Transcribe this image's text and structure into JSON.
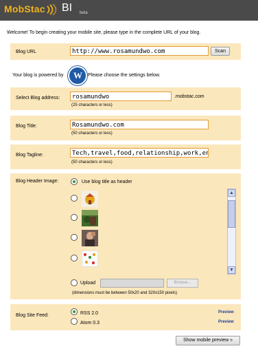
{
  "header": {
    "logo": "MobStac",
    "title": "BI",
    "beta": "beta"
  },
  "intro": "Welcome! To begin creating your mobile site, please type in the complete URL of your blog.",
  "blog_url": {
    "label": "Blog URL",
    "value": "http://www.rosamundwo.com",
    "scan": "Scan"
  },
  "powered": {
    "prefix": "Your blog is powered by",
    "suffix": "Please choose the settings below."
  },
  "address": {
    "label": "Select Blog address:",
    "value": "rosamundwo",
    "suffix": ".mobstac.com",
    "hint": "(25 characters or less)"
  },
  "title_field": {
    "label": "Blog Title:",
    "value": "Rosamundwo.com",
    "hint": "(50 characters or less)"
  },
  "tagline": {
    "label": "Blog Tagline:",
    "value": "Tech,travel,food,relationship,work,environm",
    "hint": "(50 characters or less)"
  },
  "header_image": {
    "label": "Blog Header Image:",
    "option_title": "Use blog title as header",
    "upload": "Upload",
    "browse": "Browse...",
    "dimensions": "(dimensions must be between 50x20 and 320x150 pixels)"
  },
  "feed": {
    "label": "Blog Site Feed:",
    "rss": "RSS 2.0",
    "atom": "Atom 0.3",
    "preview": "Preview"
  },
  "show_preview": "Show mobile preview »"
}
